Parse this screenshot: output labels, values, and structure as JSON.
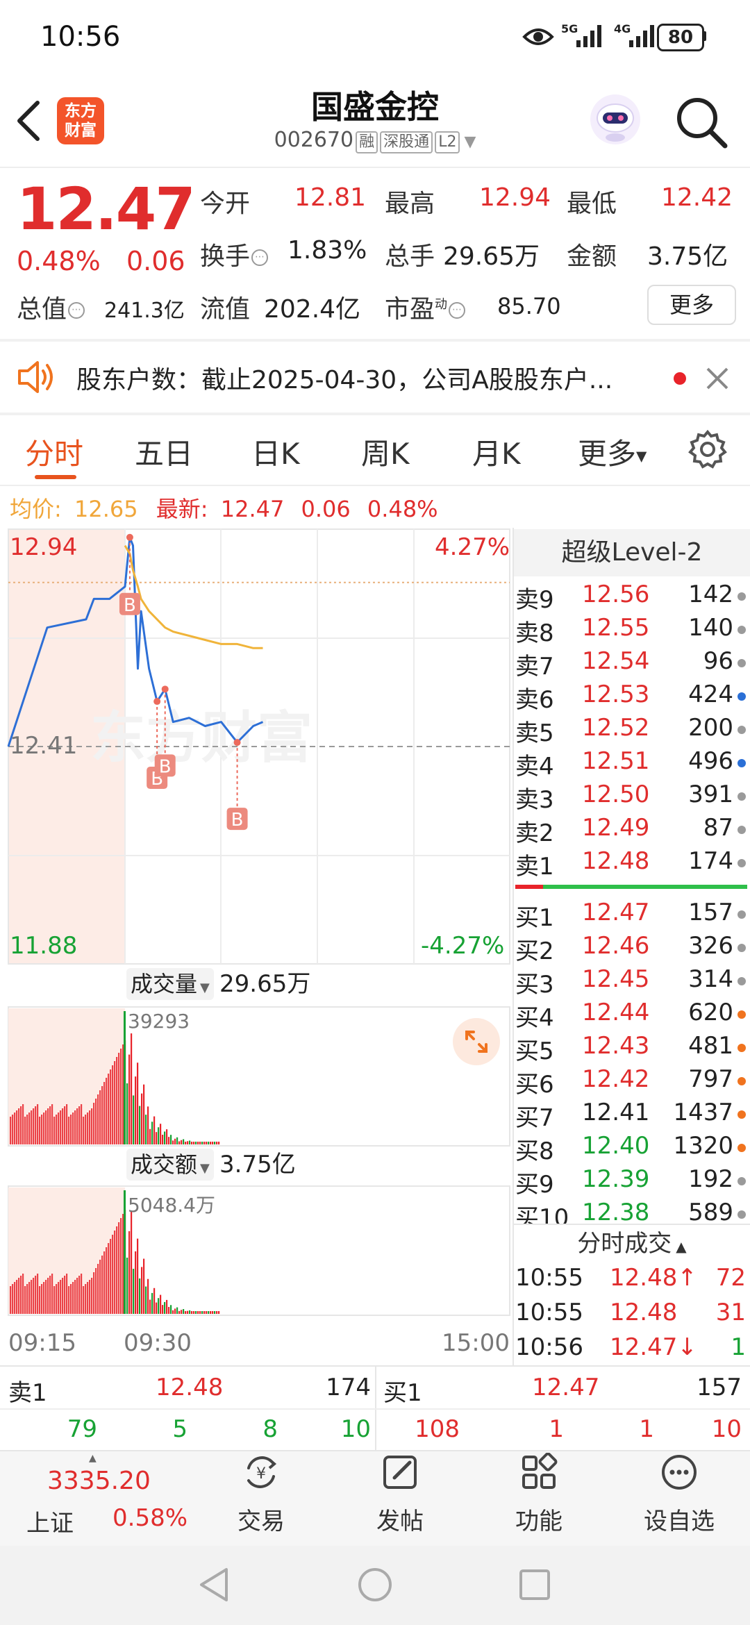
{
  "status": {
    "time": "10:56",
    "net1": "5G",
    "net2": "4G",
    "battery": "80"
  },
  "header": {
    "logo_line1": "东方",
    "logo_line2": "财富",
    "title": "国盛金控",
    "code": "002670",
    "tags": [
      "融",
      "深股通",
      "L2"
    ]
  },
  "quote": {
    "price": "12.47",
    "change_pct": "0.48%",
    "change": "0.06",
    "open_label": "今开",
    "open": "12.81",
    "high_label": "最高",
    "high": "12.94",
    "low_label": "最低",
    "low": "12.42",
    "turnover_label": "换手",
    "turnover": "1.83%",
    "volume_label": "总手",
    "volume": "29.65万",
    "amount_label": "金额",
    "amount": "3.75亿",
    "mktcap_label": "总值",
    "mktcap": "241.3亿",
    "float_label": "流值",
    "float": "202.4亿",
    "pe_label": "市盈",
    "pe_sup": "动",
    "pe": "85.70",
    "more": "更多"
  },
  "notice": {
    "text": "股东户数：截止2025-04-30，公司A股股东户..."
  },
  "tabs": [
    "分时",
    "五日",
    "日K",
    "周K",
    "月K",
    "更多"
  ],
  "info_line": {
    "avg_label": "均价:",
    "avg": "12.65",
    "last_label": "最新:",
    "last": "12.47",
    "chg": "0.06",
    "pct": "0.48%"
  },
  "chart": {
    "y_high": "12.94",
    "y_low": "11.88",
    "y_mid": "12.41",
    "pct_high": "4.27%",
    "pct_low": "-4.27%",
    "watermark": "东方财富",
    "markers": [
      "B",
      "B",
      "B",
      "B"
    ],
    "vol_label": "成交量",
    "vol_total": "29.65万",
    "vol_max": "39293",
    "amt_label": "成交额",
    "amt_total": "3.75亿",
    "amt_max": "5048.4万",
    "time_start": "09:15",
    "time_open": "09:30",
    "time_end": "15:00",
    "chart_data": {
      "type": "line",
      "xlabel": "",
      "ylabel": "",
      "ylim": [
        11.88,
        12.94
      ],
      "x": [
        "09:15",
        "09:20",
        "09:25",
        "09:26",
        "09:28",
        "09:30",
        "09:33",
        "09:35",
        "09:38",
        "09:40",
        "09:45",
        "09:50",
        "09:55",
        "10:00",
        "10:10",
        "10:20",
        "10:30",
        "10:40",
        "10:50",
        "10:56"
      ],
      "series": [
        {
          "name": "最新",
          "values": [
            12.41,
            12.7,
            12.72,
            12.77,
            12.77,
            12.8,
            12.92,
            12.9,
            12.6,
            12.74,
            12.6,
            12.52,
            12.55,
            12.47,
            12.48,
            12.46,
            12.47,
            12.42,
            12.46,
            12.47
          ]
        },
        {
          "name": "均价",
          "values": [
            null,
            null,
            null,
            null,
            null,
            12.9,
            12.88,
            12.84,
            12.8,
            12.77,
            12.74,
            12.72,
            12.7,
            12.69,
            12.68,
            12.67,
            12.66,
            12.66,
            12.65,
            12.65
          ]
        }
      ]
    }
  },
  "orderbook": {
    "title": "超级Level-2",
    "sells": [
      {
        "label": "卖9",
        "price": "12.56",
        "vol": "142",
        "dot": "gray"
      },
      {
        "label": "卖8",
        "price": "12.55",
        "vol": "140",
        "dot": "gray"
      },
      {
        "label": "卖7",
        "price": "12.54",
        "vol": "96",
        "dot": "gray"
      },
      {
        "label": "卖6",
        "price": "12.53",
        "vol": "424",
        "dot": "blue"
      },
      {
        "label": "卖5",
        "price": "12.52",
        "vol": "200",
        "dot": "gray"
      },
      {
        "label": "卖4",
        "price": "12.51",
        "vol": "496",
        "dot": "blue"
      },
      {
        "label": "卖3",
        "price": "12.50",
        "vol": "391",
        "dot": "gray"
      },
      {
        "label": "卖2",
        "price": "12.49",
        "vol": "87",
        "dot": "gray"
      },
      {
        "label": "卖1",
        "price": "12.48",
        "vol": "174",
        "dot": "gray"
      }
    ],
    "buys": [
      {
        "label": "买1",
        "price": "12.47",
        "vol": "157",
        "dot": "gray",
        "pc": "red"
      },
      {
        "label": "买2",
        "price": "12.46",
        "vol": "326",
        "dot": "gray",
        "pc": "red"
      },
      {
        "label": "买3",
        "price": "12.45",
        "vol": "314",
        "dot": "gray",
        "pc": "red"
      },
      {
        "label": "买4",
        "price": "12.44",
        "vol": "620",
        "dot": "orange",
        "pc": "red"
      },
      {
        "label": "买5",
        "price": "12.43",
        "vol": "481",
        "dot": "orange",
        "pc": "red"
      },
      {
        "label": "买6",
        "price": "12.42",
        "vol": "797",
        "dot": "orange",
        "pc": "red"
      },
      {
        "label": "买7",
        "price": "12.41",
        "vol": "1437",
        "dot": "orange",
        "pc": "dark"
      },
      {
        "label": "买8",
        "price": "12.40",
        "vol": "1320",
        "dot": "orange",
        "pc": "green"
      },
      {
        "label": "买9",
        "price": "12.39",
        "vol": "192",
        "dot": "gray",
        "pc": "green"
      },
      {
        "label": "买10",
        "price": "12.38",
        "vol": "589",
        "dot": "gray",
        "pc": "green"
      }
    ],
    "ticks_title": "分时成交",
    "ticks": [
      {
        "time": "10:55",
        "price": "12.48↑",
        "vol": "72"
      },
      {
        "time": "10:55",
        "price": "12.48",
        "vol": "31"
      },
      {
        "time": "10:56",
        "price": "12.47↓",
        "vol": "1"
      }
    ]
  },
  "bottom_bar": {
    "sell1_label": "卖1",
    "sell1_price": "12.48",
    "sell1_vol": "174",
    "buy1_label": "买1",
    "buy1_price": "12.47",
    "buy1_vol": "157",
    "sell_queue": [
      "79",
      "5",
      "8",
      "10"
    ],
    "buy_queue": [
      "108",
      "1",
      "1",
      "10"
    ]
  },
  "nav": {
    "index_value": "3335.20",
    "index_name": "上证",
    "index_pct": "0.58%",
    "items": [
      "交易",
      "发帖",
      "功能",
      "设自选"
    ]
  }
}
